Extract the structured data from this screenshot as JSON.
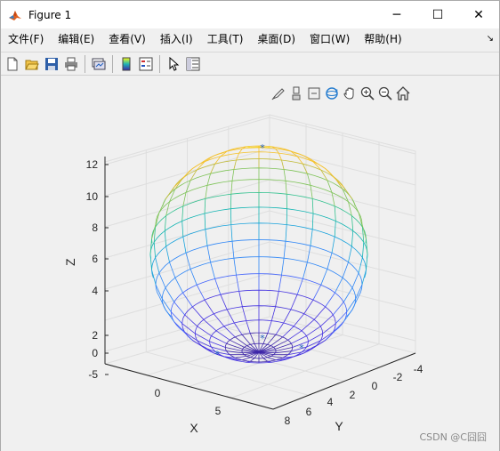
{
  "window": {
    "title": "Figure 1"
  },
  "title_buttons": {
    "minimize": "─",
    "maximize": "☐",
    "close": "✕"
  },
  "menu": [
    "文件(F)",
    "编辑(E)",
    "查看(V)",
    "插入(I)",
    "工具(T)",
    "桌面(D)",
    "窗口(W)",
    "帮助(H)"
  ],
  "toolbar_icons": [
    "new-figure-icon",
    "open-file-icon",
    "save-icon",
    "print-icon",
    "link-plot-icon",
    "colorbar-icon",
    "legend-icon",
    "pointer-icon",
    "property-inspector-icon"
  ],
  "axes_toolbar_icons": [
    "brush-icon",
    "data-tips-icon",
    "rotate-icon",
    "pan-icon",
    "zoom-in-icon",
    "zoom-out-icon",
    "home-icon"
  ],
  "chart_data": {
    "type": "surface",
    "surface": "sphere",
    "zlabel": "Z",
    "xlabel": "X",
    "ylabel": "Y",
    "z_ticks": [
      "-5",
      "0",
      "2",
      "4",
      "6",
      "8",
      "10",
      "12"
    ],
    "x_ticks": [
      "0",
      "5"
    ],
    "y_ticks": [
      "-4",
      "-2",
      "0",
      "2",
      "4",
      "6",
      "8"
    ],
    "zlim": [
      -5,
      13
    ],
    "colormap": "parula",
    "marker": "*",
    "grid": true
  },
  "watermark": "CSDN @C囧囧"
}
